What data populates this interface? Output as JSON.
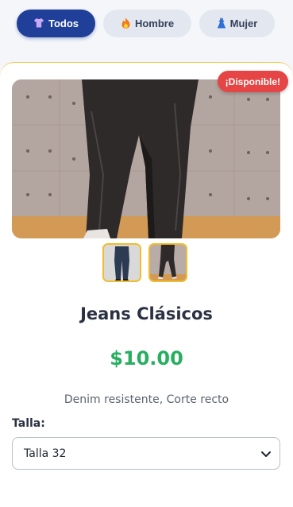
{
  "filters": [
    {
      "label": "Todos",
      "icon": "shirt-icon",
      "active": true
    },
    {
      "label": "Hombre",
      "icon": "fire-icon",
      "active": false
    },
    {
      "label": "Mujer",
      "icon": "dress-icon",
      "active": false
    }
  ],
  "product": {
    "badge": "¡Disponible!",
    "name": "Jeans Clásicos",
    "price": "$10.00",
    "description": "Denim resistente, Corte recto",
    "size_label": "Talla:",
    "size_selected": "Talla 32",
    "thumbnails": [
      "blue-jeans-thumbnail",
      "black-jeans-thumbnail"
    ]
  },
  "colors": {
    "active_filter": "#1f3f99",
    "badge": "#e54545",
    "price": "#27ae60",
    "thumb_border": "#f1bd2b"
  }
}
